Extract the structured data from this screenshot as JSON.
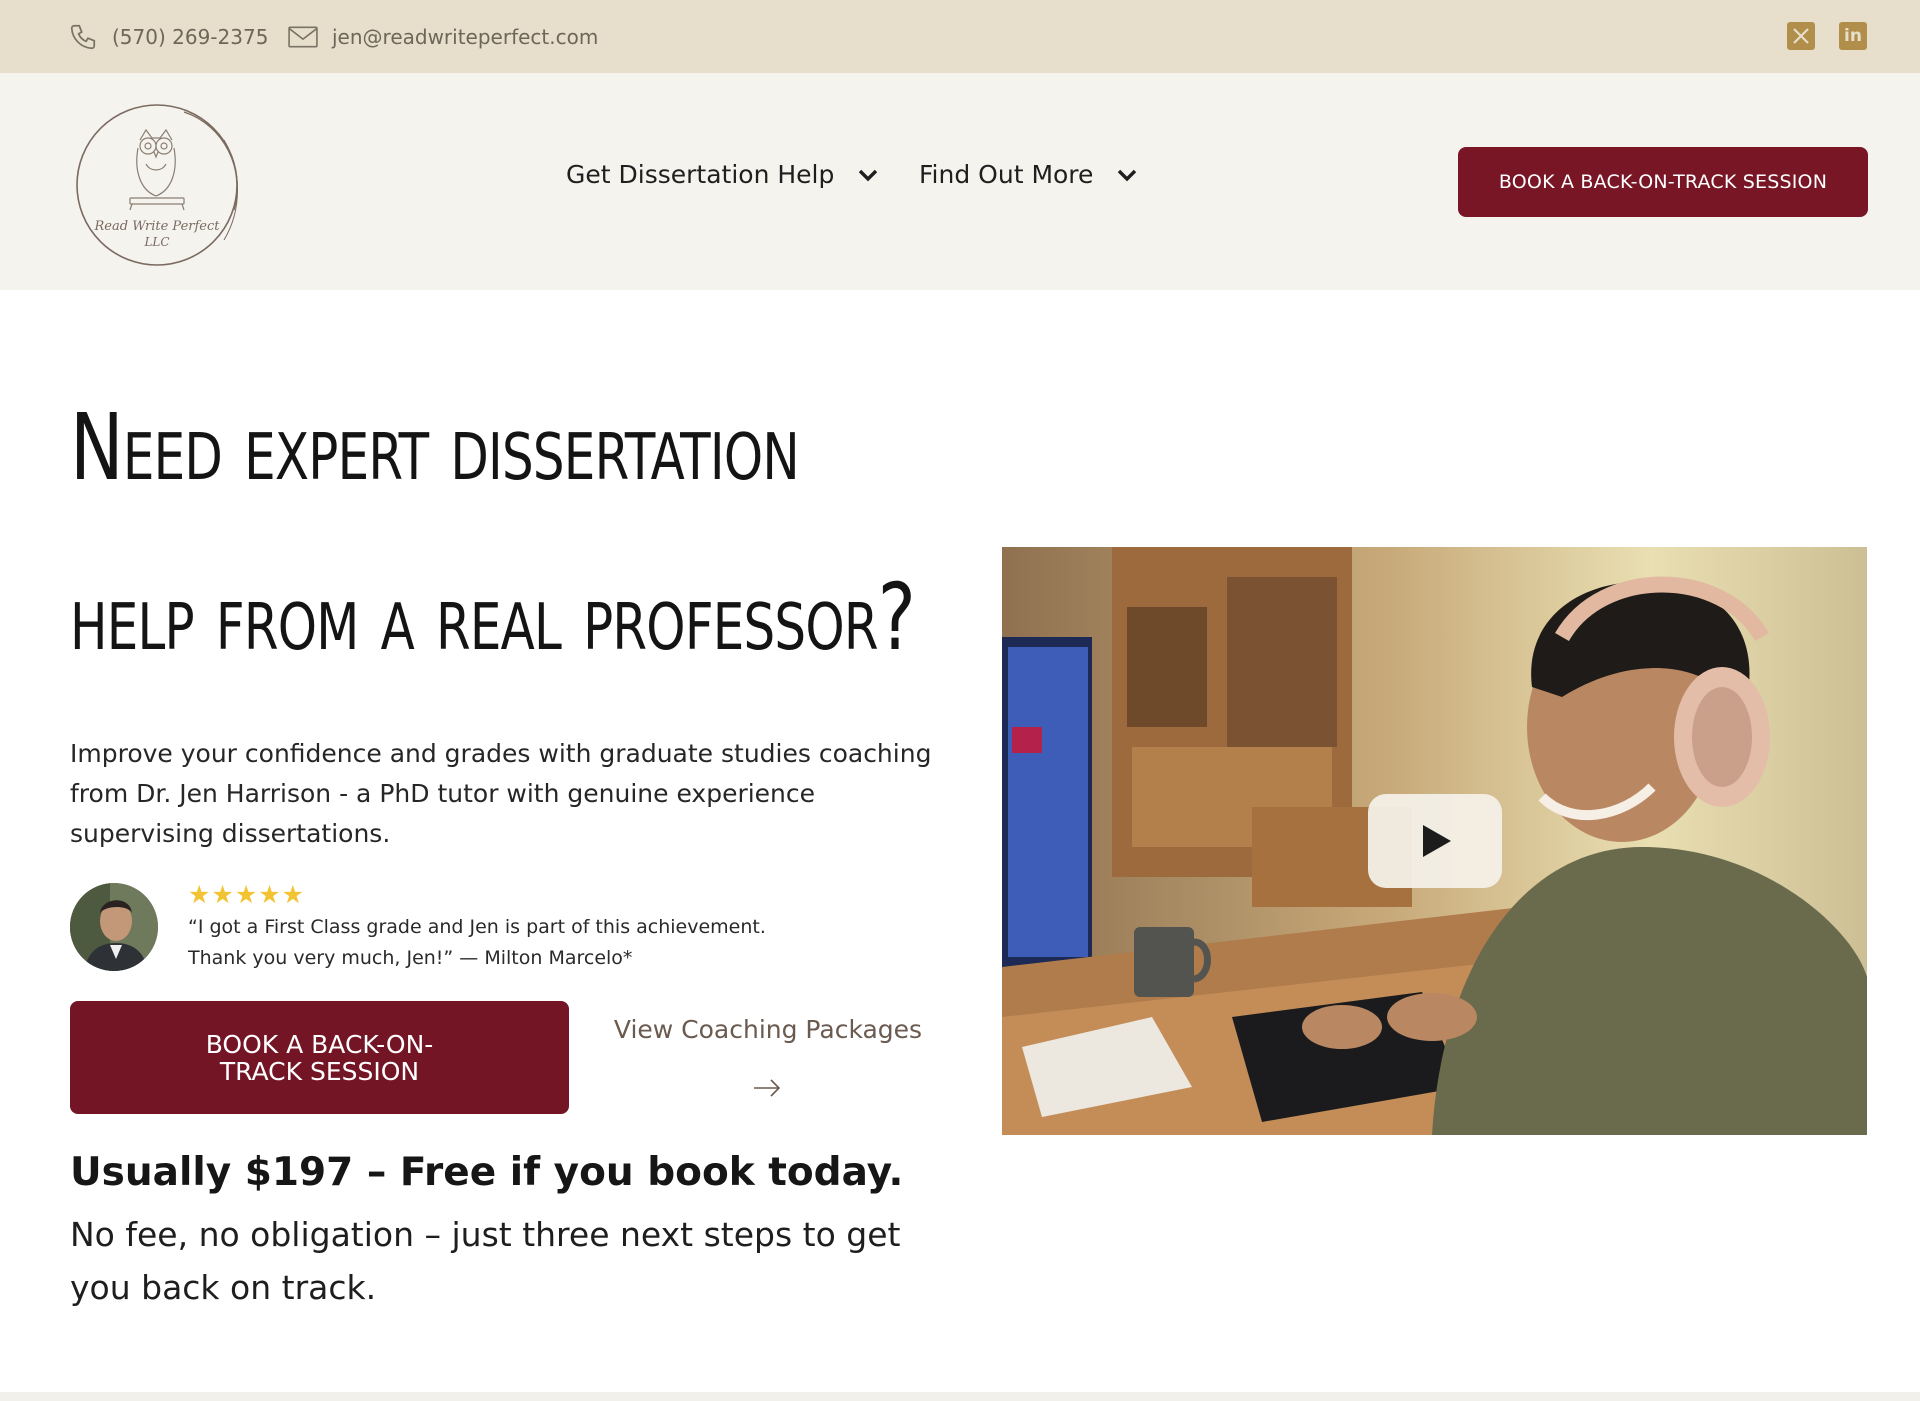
{
  "topbar": {
    "phone": "(570) 269-2375",
    "email": "jen@readwriteperfect.com",
    "phone_icon": "phone-icon",
    "email_icon": "envelope-icon",
    "social": [
      {
        "name": "x-icon",
        "glyph": "𝕏"
      },
      {
        "name": "linkedin-icon",
        "glyph": "in"
      }
    ]
  },
  "header": {
    "logo_text_line1": "Read Write Perfect",
    "logo_text_line2": "LLC",
    "nav": [
      {
        "label": "Get Dissertation Help"
      },
      {
        "label": "Find Out More"
      }
    ],
    "cta": "BOOK A BACK-ON-TRACK SESSION"
  },
  "hero": {
    "headline_line1": "Need expert dissertation",
    "headline_line2": "help from a real professor?",
    "intro": "Improve your confidence and grades with graduate studies coaching from Dr. Jen Harrison - a PhD tutor with genuine experience supervising dissertations.",
    "rating": "★★★★★",
    "quote_line1": "“I got a First Class grade and Jen is part of this achievement.",
    "quote_line2": "Thank you very much, Jen!” — Milton Marcelo*",
    "cta_primary": "BOOK A BACK-ON-TRACK SESSION",
    "cta_secondary": "View Coaching Packages",
    "price": "Usually $197 – Free if you book today.",
    "price_sub": "No fee, no obligation – just three next steps to get you back on track."
  },
  "colors": {
    "topbar_bg": "#e7dfcb",
    "header_bg": "#f5f3ee",
    "brand_maroon": "#781626",
    "social_gold": "#b18e4a",
    "star_yellow": "#f2c433"
  }
}
